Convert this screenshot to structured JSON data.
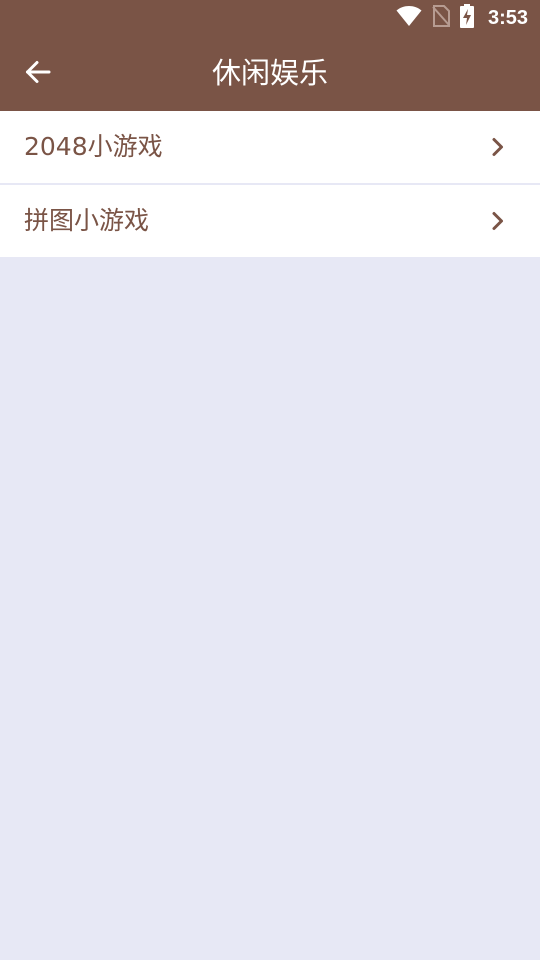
{
  "status_bar": {
    "time": "3:53",
    "icons": [
      "wifi-icon",
      "no-sim-icon",
      "battery-charging-icon"
    ]
  },
  "toolbar": {
    "back_icon": "arrow-left-icon",
    "title": "休闲娱乐"
  },
  "menu": {
    "items": [
      {
        "label": "2048小游戏",
        "icon": "chevron-right-icon"
      },
      {
        "label": "拼图小游戏",
        "icon": "chevron-right-icon"
      }
    ]
  },
  "colors": {
    "header": "#7a5446",
    "accent_text": "#7a5446",
    "background": "#e7e8f5",
    "list_item_bg": "#ffffff"
  }
}
